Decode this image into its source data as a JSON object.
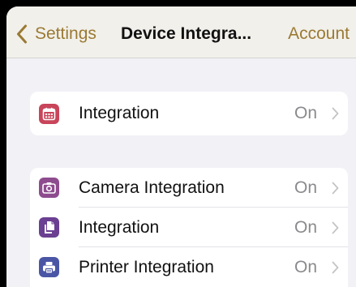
{
  "colors": {
    "accent": "#9a7a33",
    "calendar_icon": "#c8455a",
    "camera_icon": "#8e4c8f",
    "doc_icon": "#6b3f91",
    "printer_icon": "#4a56a5"
  },
  "navbar": {
    "back_label": "Settings",
    "title": "Device Integra...",
    "right_label": "Account"
  },
  "groups": [
    {
      "rows": [
        {
          "icon": "calendar-icon",
          "label": "Integration",
          "value": "On"
        }
      ]
    },
    {
      "rows": [
        {
          "icon": "camera-icon",
          "label": "Camera Integration",
          "value": "On"
        },
        {
          "icon": "document-icon",
          "label": "Integration",
          "value": "On"
        },
        {
          "icon": "printer-icon",
          "label": "Printer Integration",
          "value": "On"
        }
      ]
    }
  ]
}
